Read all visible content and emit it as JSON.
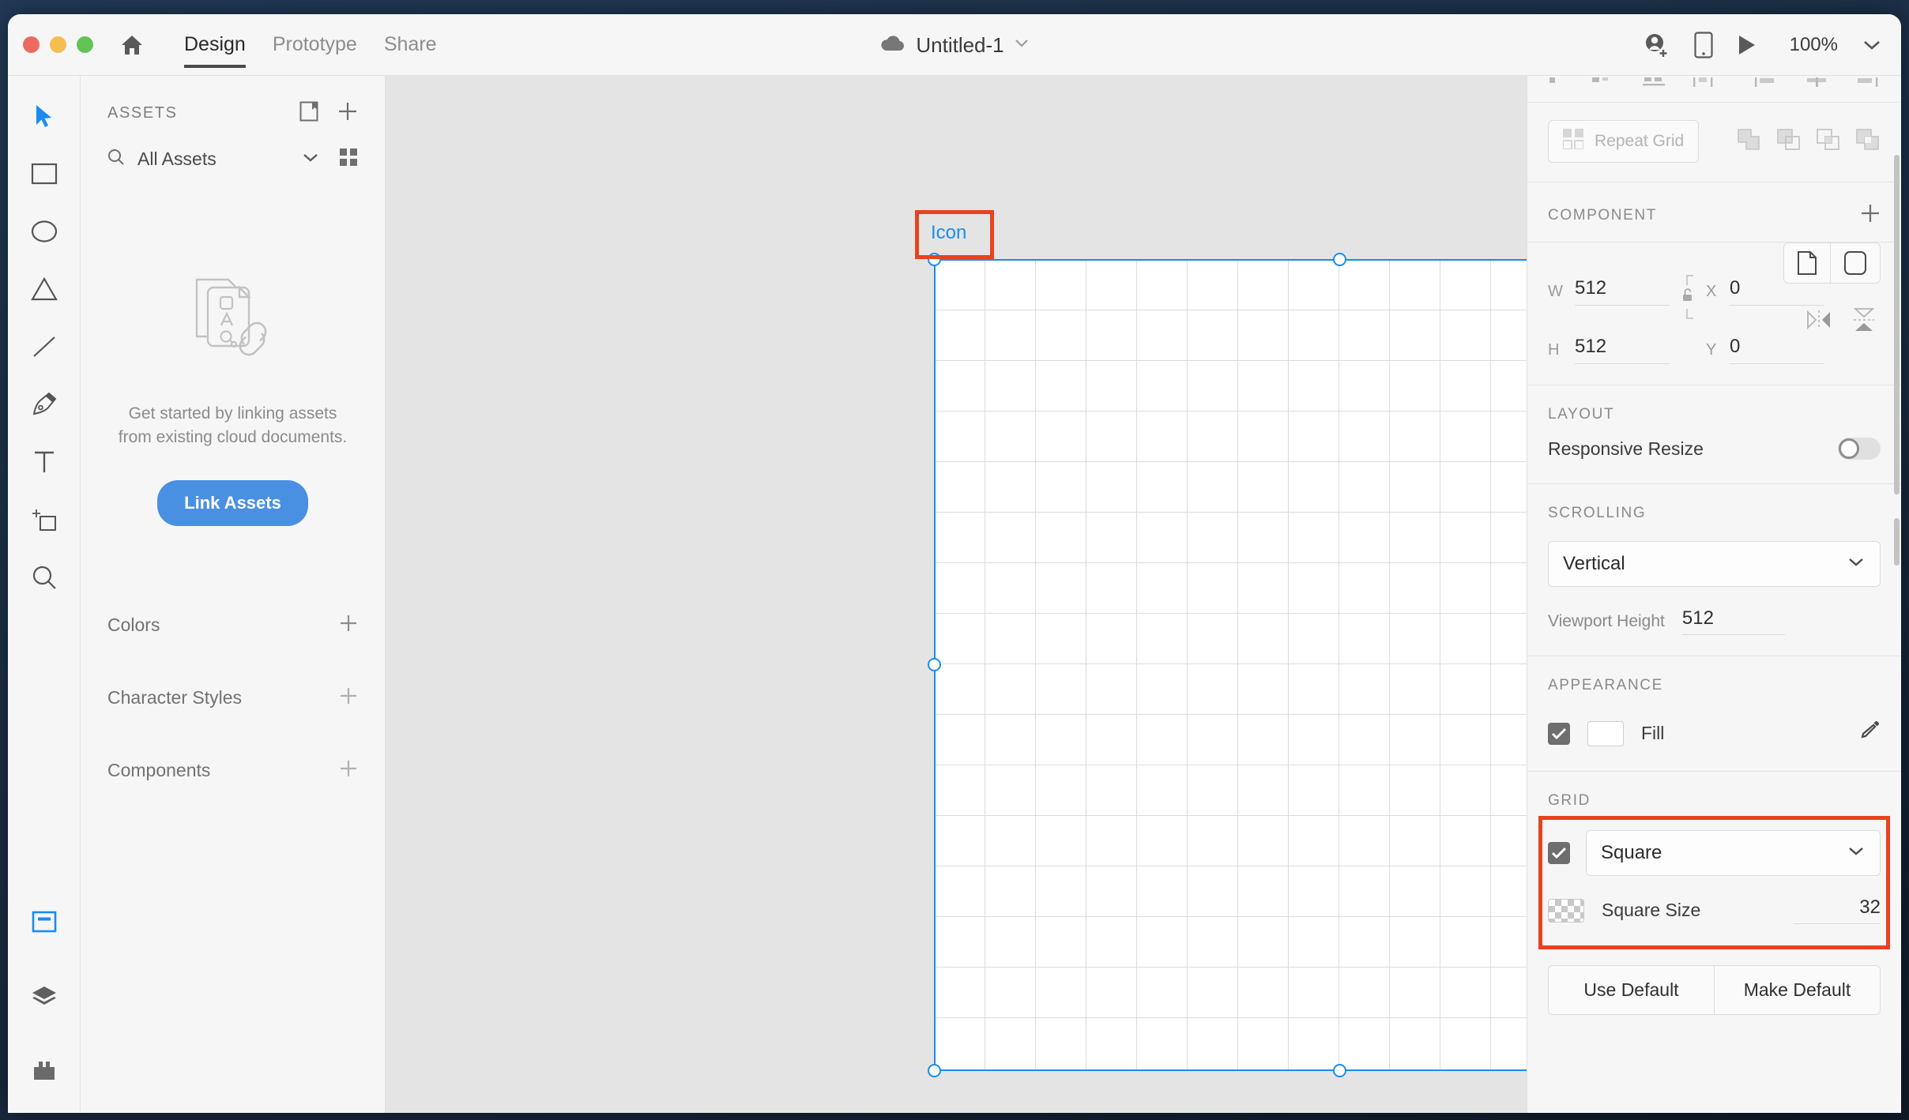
{
  "titlebar": {
    "tabs": [
      {
        "label": "Design",
        "active": true
      },
      {
        "label": "Prototype",
        "active": false
      },
      {
        "label": "Share",
        "active": false
      }
    ],
    "home_icon": "home-icon",
    "cloud_icon": "cloud-icon",
    "document_name": "Untitled-1",
    "document_chevron": "chevron-down-icon",
    "invite_icon": "add-collaborator-icon",
    "device_preview_icon": "mobile-device-icon",
    "play_icon": "play-preview-icon",
    "zoom_level": "100%",
    "zoom_chevron": "chevron-down-icon"
  },
  "toolbar": {
    "tools": [
      {
        "name": "select-tool",
        "active": true
      },
      {
        "name": "rectangle-tool",
        "active": false
      },
      {
        "name": "ellipse-tool",
        "active": false
      },
      {
        "name": "polygon-tool",
        "active": false
      },
      {
        "name": "line-tool",
        "active": false
      },
      {
        "name": "pen-tool",
        "active": false
      },
      {
        "name": "text-tool",
        "active": false
      },
      {
        "name": "artboard-tool",
        "active": false
      },
      {
        "name": "zoom-tool",
        "active": false
      }
    ],
    "bottom_tools": [
      {
        "name": "assets-panel-toggle",
        "active": true
      },
      {
        "name": "layers-panel-toggle",
        "active": false
      },
      {
        "name": "plugins-panel-toggle",
        "active": false
      }
    ]
  },
  "assets_panel": {
    "title": "ASSETS",
    "library_icon": "library-icon",
    "add_icon": "plus-icon",
    "search_icon": "search-icon",
    "filter_value": "All Assets",
    "filter_chevron": "chevron-down-icon",
    "grid_view_icon": "grid-view-icon",
    "empty_illustration": "linked-documents-illustration",
    "empty_text": "Get started by linking assets from existing cloud documents.",
    "link_button": "Link Assets",
    "sections": [
      {
        "label": "Colors",
        "add_icon": "plus-icon"
      },
      {
        "label": "Character Styles",
        "add_icon": "plus-icon"
      },
      {
        "label": "Components",
        "add_icon": "plus-icon"
      }
    ]
  },
  "canvas": {
    "artboard_name": "Icon",
    "artboard_annotated": true,
    "grid_visible": true
  },
  "properties": {
    "repeat_grid": {
      "label": "Repeat Grid",
      "icon": "repeat-grid-icon",
      "enabled": false
    },
    "boolean_ops": [
      "add-shapes-icon",
      "subtract-shapes-icon",
      "intersect-shapes-icon",
      "exclude-overlap-icon"
    ],
    "component": {
      "title": "COMPONENT",
      "add_icon": "plus-icon"
    },
    "dimensions": {
      "w_label": "W",
      "w_value": "512",
      "h_label": "H",
      "h_value": "512",
      "x_label": "X",
      "x_value": "0",
      "y_label": "Y",
      "y_value": "0",
      "lock_icon": "unlocked-aspect-ratio-icon",
      "corner_square_icon": "sharp-corner-icon",
      "corner_round_icon": "rounded-corner-icon",
      "flip_horizontal_icon": "flip-horizontal-icon",
      "flip_vertical_icon": "flip-vertical-icon"
    },
    "layout": {
      "title": "LAYOUT",
      "responsive_resize_label": "Responsive Resize",
      "responsive_resize_on": false
    },
    "scrolling": {
      "title": "SCROLLING",
      "mode_value": "Vertical",
      "mode_chevron": "chevron-down-icon",
      "viewport_height_label": "Viewport Height",
      "viewport_height_value": "512"
    },
    "appearance": {
      "title": "APPEARANCE",
      "fill_checked": true,
      "fill_label": "Fill",
      "fill_color": "#ffffff",
      "eyedropper_icon": "eyedropper-icon"
    },
    "grid": {
      "title": "GRID",
      "enabled": true,
      "type_value": "Square",
      "type_chevron": "chevron-down-icon",
      "square_size_label": "Square Size",
      "square_size_value": "32",
      "annotated": true
    },
    "defaults": {
      "use_default": "Use Default",
      "make_default": "Make Default"
    }
  },
  "colors": {
    "accent_blue": "#1a8cf0",
    "button_blue": "#4a90e2",
    "annotation_red": "#e8431f",
    "panel_bg": "#f6f6f6",
    "canvas_bg": "#e4e4e4"
  }
}
